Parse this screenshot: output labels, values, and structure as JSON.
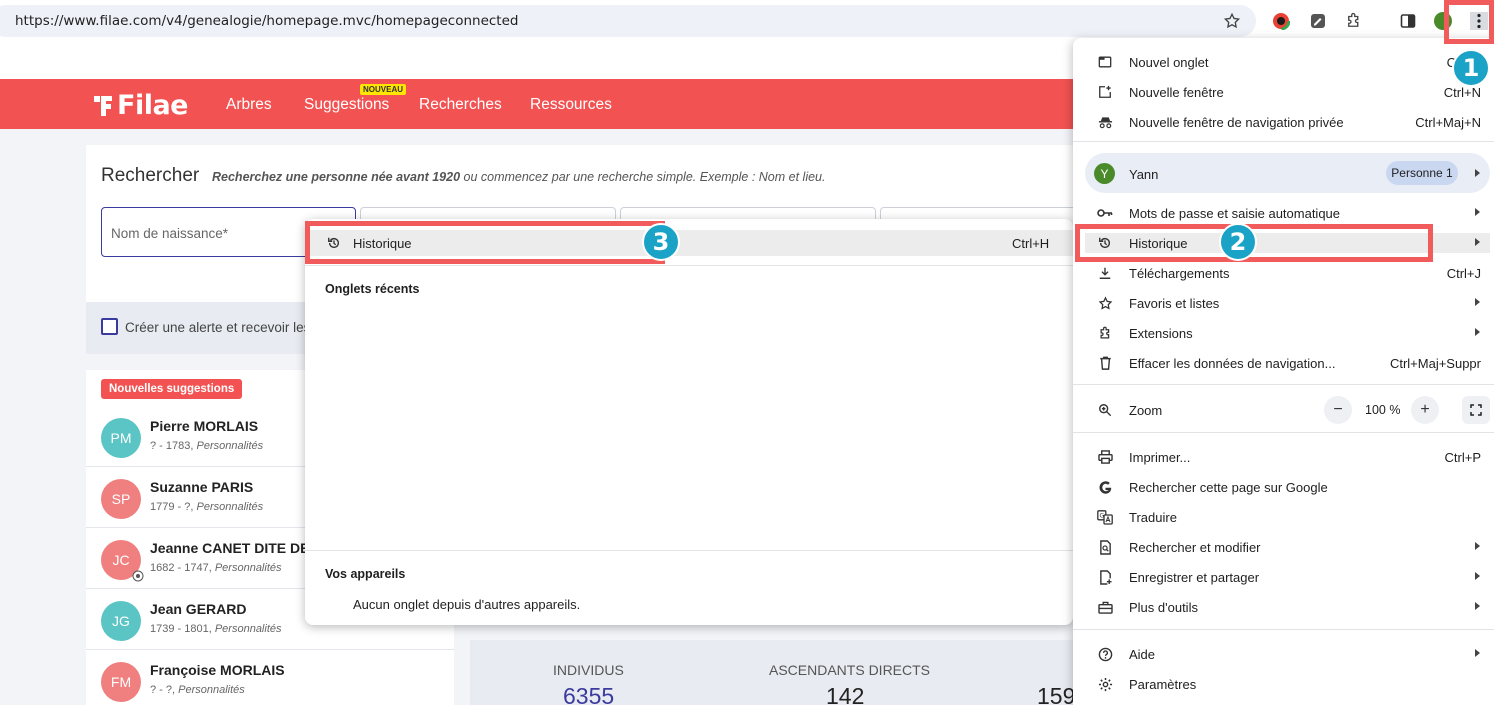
{
  "browser": {
    "url": "https://www.filae.com/v4/genealogie/homepage.mvc/homepageconnected"
  },
  "site": {
    "logo": "Filae",
    "nav": [
      "Arbres",
      "Suggestions",
      "Recherches",
      "Ressources"
    ],
    "new_badge": "NOUVEAU",
    "accent_color": "#f25252"
  },
  "search": {
    "title": "Rechercher",
    "subtitle_bold": "Recherchez une personne née avant 1920",
    "subtitle_rest": " ou commencez par une recherche simple. Exemple : Nom et lieu.",
    "name_placeholder": "Nom de naissance*",
    "alert_label": "Créer une alerte et recevoir les f"
  },
  "suggestions": {
    "badge": "Nouvelles suggestions",
    "people": [
      {
        "initials": "PM",
        "name": "Pierre MORLAIS",
        "dates": "? - 1783, ",
        "tag": "Personnalités",
        "color": "#5bc5c5"
      },
      {
        "initials": "SP",
        "name": "Suzanne PARIS",
        "dates": "1779 - ?, ",
        "tag": "Personnalités",
        "color": "#f07f7f"
      },
      {
        "initials": "JC",
        "name": "Jeanne CANET DITE DE C",
        "dates": "1682 - 1747, ",
        "tag": "Personnalités",
        "color": "#f07f7f"
      },
      {
        "initials": "JG",
        "name": "Jean GERARD",
        "dates": "1739 - 1801, ",
        "tag": "Personnalités",
        "color": "#5bc5c5"
      },
      {
        "initials": "FM",
        "name": "Françoise MORLAIS",
        "dates": "? - ?, ",
        "tag": "Personnalités",
        "color": "#f07f7f"
      }
    ]
  },
  "stats": [
    {
      "label": "INDIVIDUS",
      "value": "6355",
      "color": "#3b3a9e"
    },
    {
      "label": "ASCENDANTS DIRECTS",
      "value": "142",
      "color": "#222222"
    },
    {
      "label": "",
      "value": "159",
      "color": "#222222"
    }
  ],
  "history_submenu": {
    "title": "Historique",
    "shortcut": "Ctrl+H",
    "recent_tabs_heading": "Onglets récents",
    "devices_heading": "Vos appareils",
    "devices_empty": "Aucun onglet depuis d'autres appareils."
  },
  "chrome_menu": {
    "items_top": [
      {
        "label": "Nouvel onglet",
        "shortcut": "Ctrl+T",
        "icon": "new-tab-icon"
      },
      {
        "label": "Nouvelle fenêtre",
        "shortcut": "Ctrl+N",
        "icon": "new-window-icon"
      },
      {
        "label": "Nouvelle fenêtre de navigation privée",
        "shortcut": "Ctrl+Maj+N",
        "icon": "incognito-icon"
      }
    ],
    "profile": {
      "initial": "Y",
      "name": "Yann",
      "chip": "Personne 1"
    },
    "items_mid": [
      {
        "label": "Mots de passe et saisie automatique",
        "shortcut": "",
        "icon": "key-icon",
        "arrow": true
      },
      {
        "label": "Historique",
        "shortcut": "",
        "icon": "history-icon",
        "arrow": true
      },
      {
        "label": "Téléchargements",
        "shortcut": "Ctrl+J",
        "icon": "download-icon",
        "arrow": false
      },
      {
        "label": "Favoris et listes",
        "shortcut": "",
        "icon": "star-icon",
        "arrow": true
      },
      {
        "label": "Extensions",
        "shortcut": "",
        "icon": "puzzle-icon",
        "arrow": true
      },
      {
        "label": "Effacer les données de navigation...",
        "shortcut": "Ctrl+Maj+Suppr",
        "icon": "trash-icon",
        "arrow": false
      }
    ],
    "zoom": {
      "label": "Zoom",
      "value": "100 %",
      "minus": "−",
      "plus": "+"
    },
    "items_low": [
      {
        "label": "Imprimer...",
        "shortcut": "Ctrl+P",
        "icon": "print-icon",
        "arrow": false
      },
      {
        "label": "Rechercher cette page sur Google",
        "shortcut": "",
        "icon": "google-icon",
        "arrow": false
      },
      {
        "label": "Traduire",
        "shortcut": "",
        "icon": "translate-icon",
        "arrow": false
      },
      {
        "label": "Rechercher et modifier",
        "shortcut": "",
        "icon": "find-icon",
        "arrow": true
      },
      {
        "label": "Enregistrer et partager",
        "shortcut": "",
        "icon": "save-share-icon",
        "arrow": true
      },
      {
        "label": "Plus d'outils",
        "shortcut": "",
        "icon": "toolbox-icon",
        "arrow": true
      }
    ],
    "items_bottom": [
      {
        "label": "Aide",
        "shortcut": "",
        "icon": "help-icon",
        "arrow": true
      },
      {
        "label": "Paramètres",
        "shortcut": "",
        "icon": "settings-icon",
        "arrow": false
      }
    ]
  },
  "annotations": [
    "1",
    "2",
    "3"
  ]
}
